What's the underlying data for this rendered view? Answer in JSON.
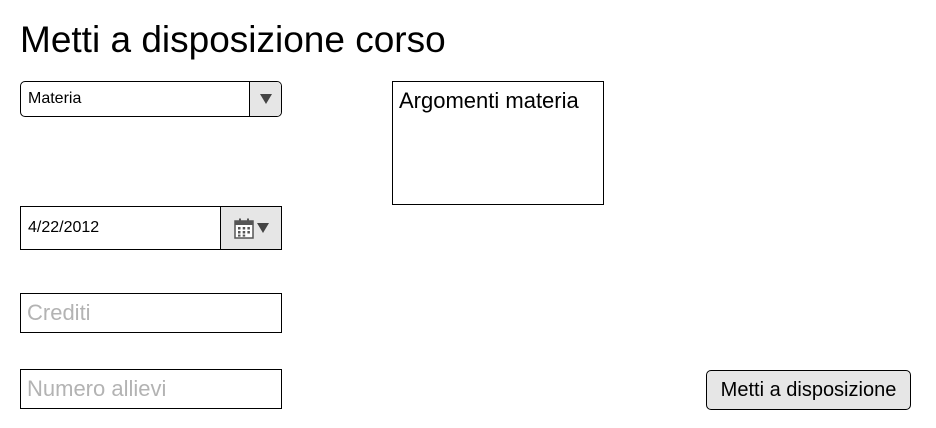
{
  "page": {
    "title": "Metti a disposizione corso"
  },
  "form": {
    "materia_select": {
      "selected": "Materia"
    },
    "argomenti": {
      "text": "Argomenti materia"
    },
    "date": {
      "value": "4/22/2012",
      "icon": "calendar-icon"
    },
    "crediti": {
      "placeholder": "Crediti"
    },
    "numero_allievi": {
      "placeholder": "Numero allievi"
    },
    "submit": {
      "label": "Metti a disposizione"
    }
  }
}
